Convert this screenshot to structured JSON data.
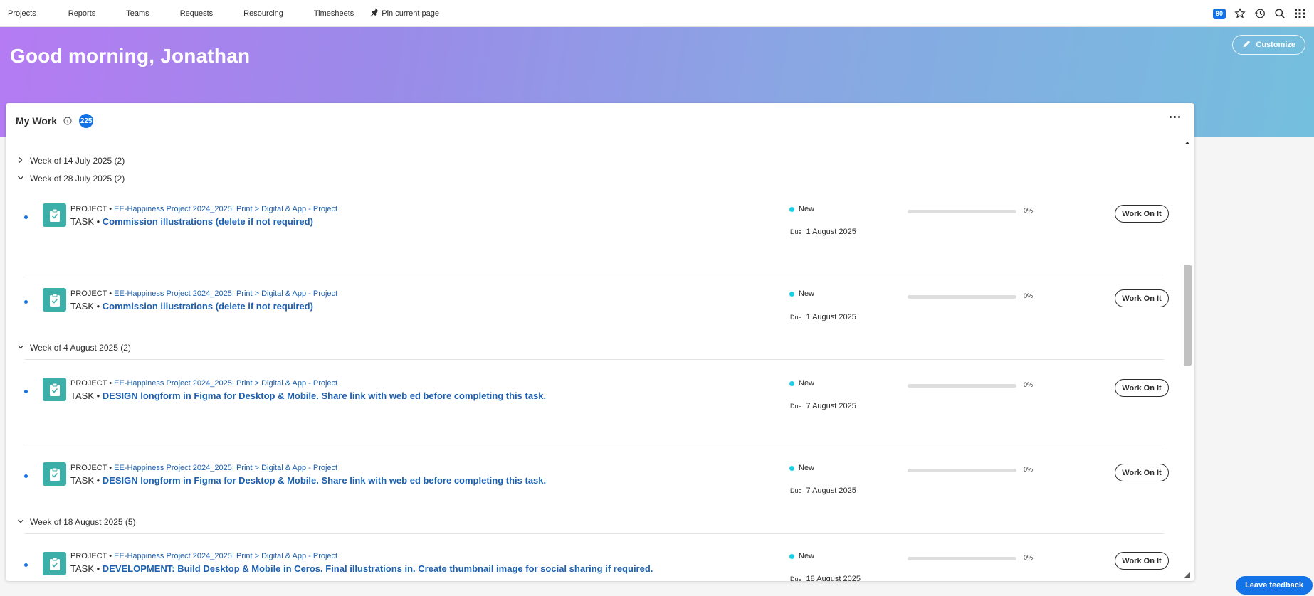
{
  "nav": {
    "items": [
      "Projects",
      "Reports",
      "Teams",
      "Requests",
      "Resourcing",
      "Timesheets"
    ],
    "pin_label": "Pin current page",
    "notification_count": "80"
  },
  "hero": {
    "greeting": "Good morning, Jonathan",
    "customize_label": "Customize"
  },
  "card": {
    "title": "My Work",
    "count": "225",
    "groups": [
      {
        "label": "Week of 14 July 2025 (2)",
        "expanded": false
      },
      {
        "label": "Week of 28 July 2025 (2)",
        "expanded": true
      },
      {
        "label": "Week of 4 August 2025 (2)",
        "expanded": true
      },
      {
        "label": "Week of 18 August 2025 (5)",
        "expanded": true
      }
    ],
    "rows": [
      {
        "project_prefix": "PROJECT •",
        "project": "EE-Happiness Project 2024_2025: Print > Digital & App - Project",
        "task_prefix": "TASK •",
        "task": "Commission illustrations (delete if not required)",
        "status": "New",
        "due_label": "Due",
        "due": "1 August 2025",
        "progress": 0,
        "progress_label": "0%",
        "button": "Work On It"
      },
      {
        "project_prefix": "PROJECT •",
        "project": "EE-Happiness Project 2024_2025: Print > Digital & App - Project",
        "task_prefix": "TASK •",
        "task": "Commission illustrations (delete if not required)",
        "status": "New",
        "due_label": "Due",
        "due": "1 August 2025",
        "progress": 0,
        "progress_label": "0%",
        "button": "Work On It"
      },
      {
        "project_prefix": "PROJECT •",
        "project": "EE-Happiness Project 2024_2025: Print > Digital & App - Project",
        "task_prefix": "TASK •",
        "task": "DESIGN longform in Figma for Desktop & Mobile. Share link with web ed before completing this task.",
        "status": "New",
        "due_label": "Due",
        "due": "7 August 2025",
        "progress": 0,
        "progress_label": "0%",
        "button": "Work On It"
      },
      {
        "project_prefix": "PROJECT •",
        "project": "EE-Happiness Project 2024_2025: Print > Digital & App - Project",
        "task_prefix": "TASK •",
        "task": "DESIGN longform in Figma for Desktop & Mobile. Share link with web ed before completing this task.",
        "status": "New",
        "due_label": "Due",
        "due": "7 August 2025",
        "progress": 0,
        "progress_label": "0%",
        "button": "Work On It"
      },
      {
        "project_prefix": "PROJECT •",
        "project": "EE-Happiness Project 2024_2025: Print > Digital & App - Project",
        "task_prefix": "TASK •",
        "task": "DEVELOPMENT: Build Desktop & Mobile in Ceros. Final illustrations in. Create thumbnail image for social sharing if required.",
        "status": "New",
        "due_label": "Due",
        "due": "18 August 2025",
        "progress": 0,
        "progress_label": "0%",
        "button": "Work On It"
      }
    ]
  },
  "feedback_label": "Leave feedback",
  "colors": {
    "accent": "#1473e6",
    "link": "#1d60b0",
    "status_new": "#18d0e6",
    "task_icon": "#3cb0a8"
  },
  "icons": [
    "pin-icon",
    "star-icon",
    "history-icon",
    "search-icon",
    "apps-grid-icon",
    "pencil-icon",
    "info-icon",
    "more-icon",
    "chevron-right-icon",
    "chevron-down-icon",
    "clipboard-check-icon"
  ]
}
